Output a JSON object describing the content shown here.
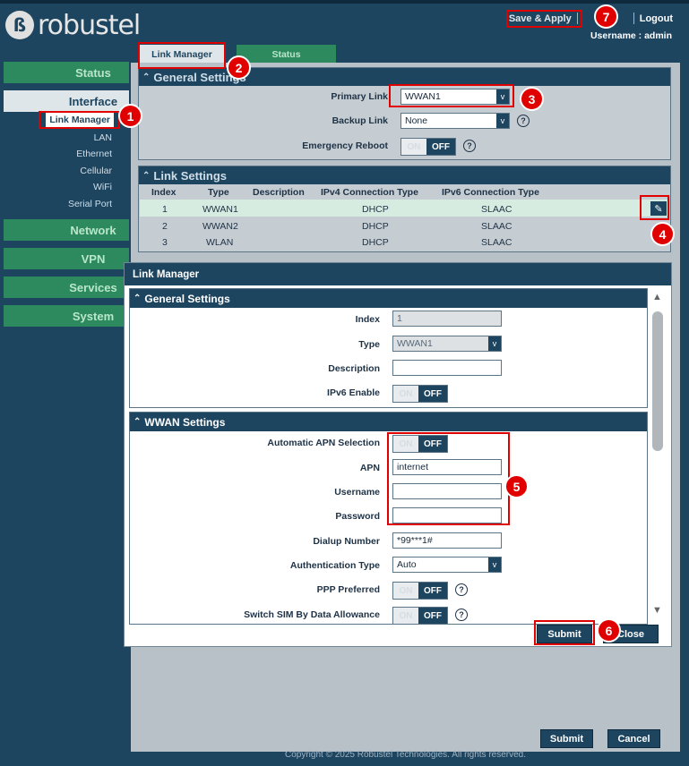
{
  "header": {
    "logo_text": "robustel",
    "save_apply": "Save & Apply",
    "logout": "Logout",
    "username_line": "Username : admin"
  },
  "sidebar": {
    "status": "Status",
    "interface": "Interface",
    "sub_items": [
      "Link Manager",
      "LAN",
      "Ethernet",
      "Cellular",
      "WiFi",
      "Serial Port"
    ],
    "network": "Network",
    "vpn": "VPN",
    "services": "Services",
    "system": "System"
  },
  "tabs": {
    "link_manager": "Link Manager",
    "status": "Status"
  },
  "general": {
    "title": "General Settings",
    "primary_link_label": "Primary Link",
    "primary_link_value": "WWAN1",
    "backup_link_label": "Backup Link",
    "backup_link_value": "None",
    "emergency_reboot_label": "Emergency Reboot",
    "toggle_on": "ON",
    "toggle_off": "OFF"
  },
  "link_settings": {
    "title": "Link Settings",
    "columns": [
      "Index",
      "Type",
      "Description",
      "IPv4 Connection Type",
      "IPv6 Connection Type"
    ],
    "rows": [
      [
        "1",
        "WWAN1",
        "",
        "DHCP",
        "SLAAC"
      ],
      [
        "2",
        "WWAN2",
        "",
        "DHCP",
        "SLAAC"
      ],
      [
        "3",
        "WLAN",
        "",
        "DHCP",
        "SLAAC"
      ]
    ]
  },
  "modal": {
    "title": "Link Manager",
    "general_title": "General Settings",
    "index_label": "Index",
    "index_value": "1",
    "type_label": "Type",
    "type_value": "WWAN1",
    "description_label": "Description",
    "ipv6_label": "IPv6 Enable",
    "wwan_title": "WWAN Settings",
    "auto_apn_label": "Automatic APN Selection",
    "apn_label": "APN",
    "apn_value": "internet",
    "username_label": "Username",
    "password_label": "Password",
    "dialup_label": "Dialup Number",
    "dialup_value": "*99***1#",
    "auth_label": "Authentication Type",
    "auth_value": "Auto",
    "ppp_label": "PPP Preferred",
    "switch_sim_label": "Switch SIM By Data Allowance",
    "submit": "Submit",
    "close": "Close"
  },
  "page_buttons": {
    "submit": "Submit",
    "cancel": "Cancel"
  },
  "footer": "Copyright © 2025 Robustel Technologies. All rights reserved.",
  "badges": [
    "1",
    "2",
    "3",
    "4",
    "5",
    "6",
    "7"
  ],
  "colors": {
    "navy": "#1e4560",
    "green": "#2c8a5e",
    "annotation_red": "#e00000"
  }
}
